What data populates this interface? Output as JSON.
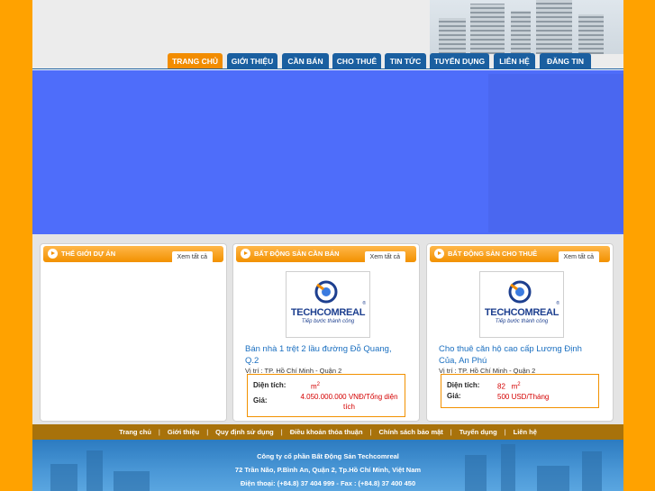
{
  "nav": {
    "items": [
      {
        "label": "TRANG CHỦ",
        "active": true
      },
      {
        "label": "GIỚI THIỆU",
        "active": false
      },
      {
        "label": "CẦN BÁN",
        "active": false
      },
      {
        "label": "CHO THUÊ",
        "active": false
      },
      {
        "label": "TIN TỨC",
        "active": false
      },
      {
        "label": "TUYỂN DỤNG",
        "active": false
      },
      {
        "label": "LIÊN HỆ",
        "active": false
      },
      {
        "label": "ĐĂNG TIN",
        "active": false
      }
    ]
  },
  "boxes": {
    "projects": {
      "title": "THẾ GIỚI DỰ ÁN",
      "see_all": "Xem tất cả"
    },
    "for_sale": {
      "title": "BẤT ĐỘNG SẢN CẦN BÁN",
      "see_all": "Xem tất cả",
      "logo_text": "TECHCOMREAL",
      "logo_slogan": "Tiếp bước thành công",
      "item_title": "Bán nhà 1 trệt 2 lầu đường Đỗ Quang, Q.2",
      "location": "Vị trí : TP. Hồ Chí Minh - Quận 2",
      "area_label": "Diện tích:",
      "area_value": "",
      "area_unit": "m",
      "area_sup": "2",
      "price_label": "Giá:",
      "price_value": "4.050.000.000 VNĐ/Tổng diện tích"
    },
    "for_rent": {
      "title": "BẤT ĐỘNG SẢN CHO THUÊ",
      "see_all": "Xem tất cả",
      "logo_text": "TECHCOMREAL",
      "logo_slogan": "Tiếp bước thành công",
      "item_title": "Cho thuê căn hộ cao cấp Lương Định Của, An Phú",
      "location": "Vị trí : TP. Hồ Chí Minh - Quận 2",
      "area_label": "Diện tích:",
      "area_value": "82",
      "area_unit": "m",
      "area_sup": "2",
      "price_label": "Giá:",
      "price_value": "500 USD/Tháng"
    }
  },
  "footer": {
    "links": [
      "Trang chủ",
      "Giới thiệu",
      "Quy định sử dụng",
      "Điều khoản thỏa thuận",
      "Chính sách bảo mật",
      "Tuyển dụng",
      "Liên hệ"
    ],
    "separator": "|",
    "company": "Công ty cổ phần Bất Động Sản Techcomreal",
    "address": "72 Trần Não, P.Bình An, Quận 2, Tp.Hồ Chí Minh, Việt Nam",
    "contact": "Điện thoại: (+84.8) 37 404 999 - Fax : (+84.8) 37 400 450"
  },
  "colors": {
    "accent": "#ffa200",
    "nav": "#1a5fa0",
    "nav_active": "#f28c00",
    "banner": "#4e6dfa",
    "price": "#d40000",
    "link": "#1a6fc0"
  }
}
